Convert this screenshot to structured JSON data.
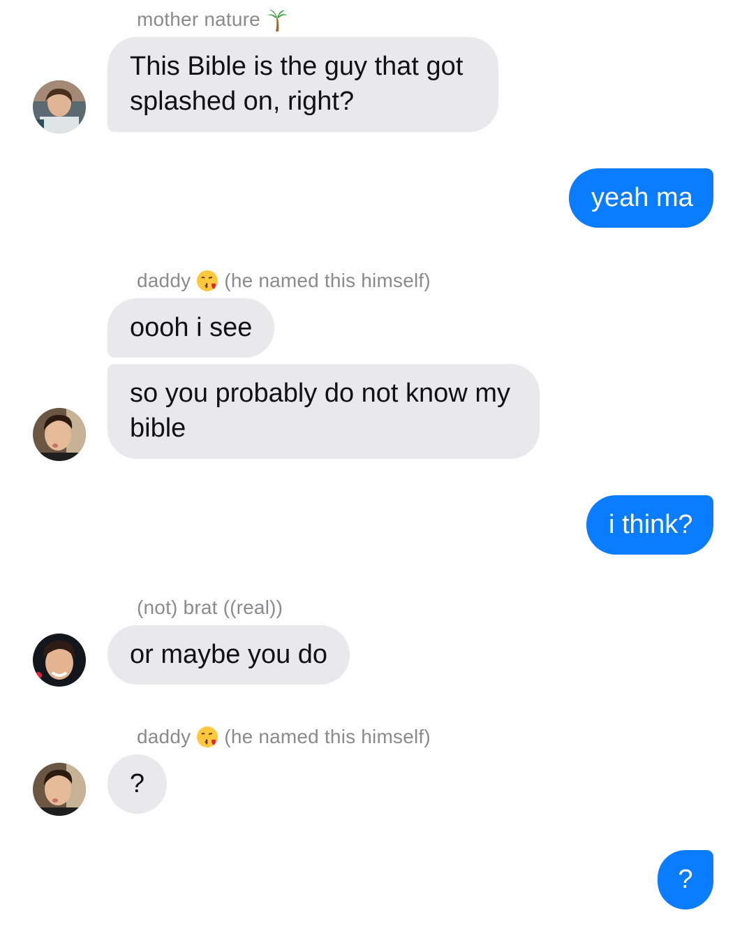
{
  "messages": [
    {
      "sender": "mother nature",
      "sender_emoji": "palm-tree",
      "text_line1": "This Bible is the guy that got",
      "text_line2": "splashed on, right?"
    },
    {
      "from_me": true,
      "text": "yeah ma"
    },
    {
      "sender": "daddy",
      "sender_emoji": "kissing-face",
      "sender_note": "(he named this himself)",
      "text": "oooh i see"
    },
    {
      "text_line1": "so you probably do not know my",
      "text_line2": "bible"
    },
    {
      "from_me": true,
      "text": "i think?"
    },
    {
      "sender": "(not) brat ((real))",
      "text": "or maybe you do"
    },
    {
      "sender": "daddy",
      "sender_emoji": "kissing-face",
      "sender_note": "(he named this himself)",
      "text": "?"
    },
    {
      "from_me": true,
      "text": "?"
    }
  ],
  "colors": {
    "incoming_bubble": "#e9e9eb",
    "outgoing_bubble": "#0a7cff",
    "sender_name": "#8a8a8f"
  }
}
